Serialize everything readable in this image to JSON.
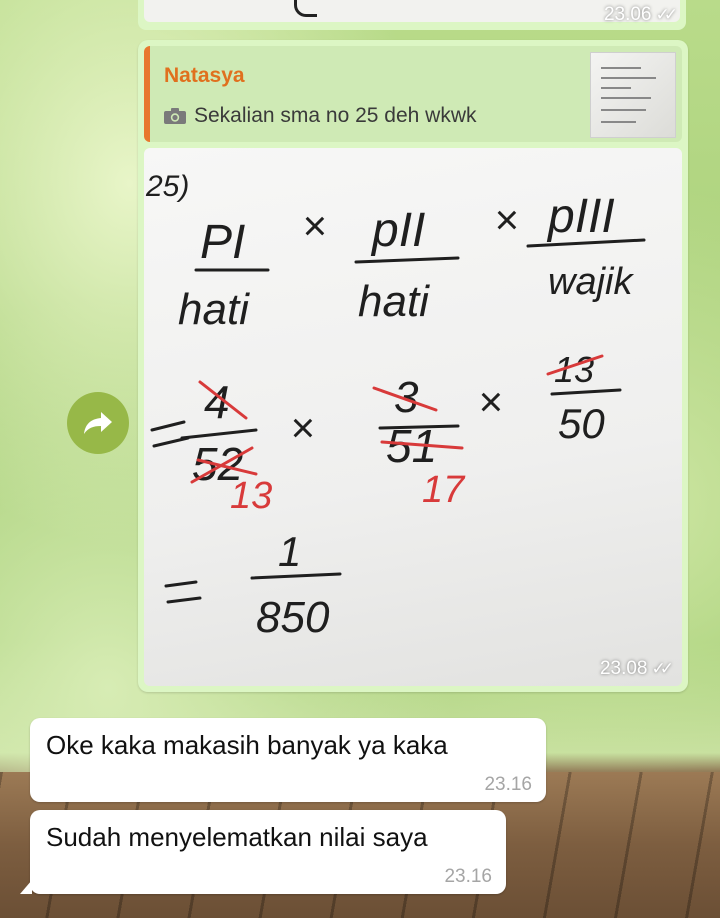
{
  "previous_message": {
    "time": "23.06",
    "status": "read"
  },
  "quoted_reply": {
    "author": "Natasya",
    "caption": "Sekalian sma no 25 deh wkwk",
    "media_icon": "camera-icon"
  },
  "photo_message": {
    "time": "23.08",
    "status": "read",
    "handwriting": {
      "number": "25)",
      "fractions": [
        {
          "numerator": "PI",
          "denominator": "hati"
        },
        {
          "numerator": "pII",
          "denominator": "hati"
        },
        {
          "numerator": "pIII",
          "denominator": "wajik"
        }
      ],
      "times": "×",
      "equals": "=",
      "step2": [
        {
          "numerator": "4",
          "denominator": "52",
          "reduced": "13"
        },
        {
          "numerator": "3",
          "denominator": "51",
          "reduced": "17"
        },
        {
          "numerator": "13",
          "denominator": "50"
        }
      ],
      "result": {
        "numerator": "1",
        "denominator": "850"
      }
    }
  },
  "forward_button": {
    "icon": "forward-arrow-icon"
  },
  "incoming_messages": [
    {
      "text": "Oke kaka makasih banyak ya kaka",
      "time": "23.16"
    },
    {
      "text": "Sudah menyelematkan nilai saya",
      "time": "23.16"
    }
  ],
  "colors": {
    "outgoing_bubble": "#dcf6c4",
    "quote_accent": "#e8772e",
    "incoming_bubble": "#ffffff",
    "forward_button": "#97b848"
  }
}
